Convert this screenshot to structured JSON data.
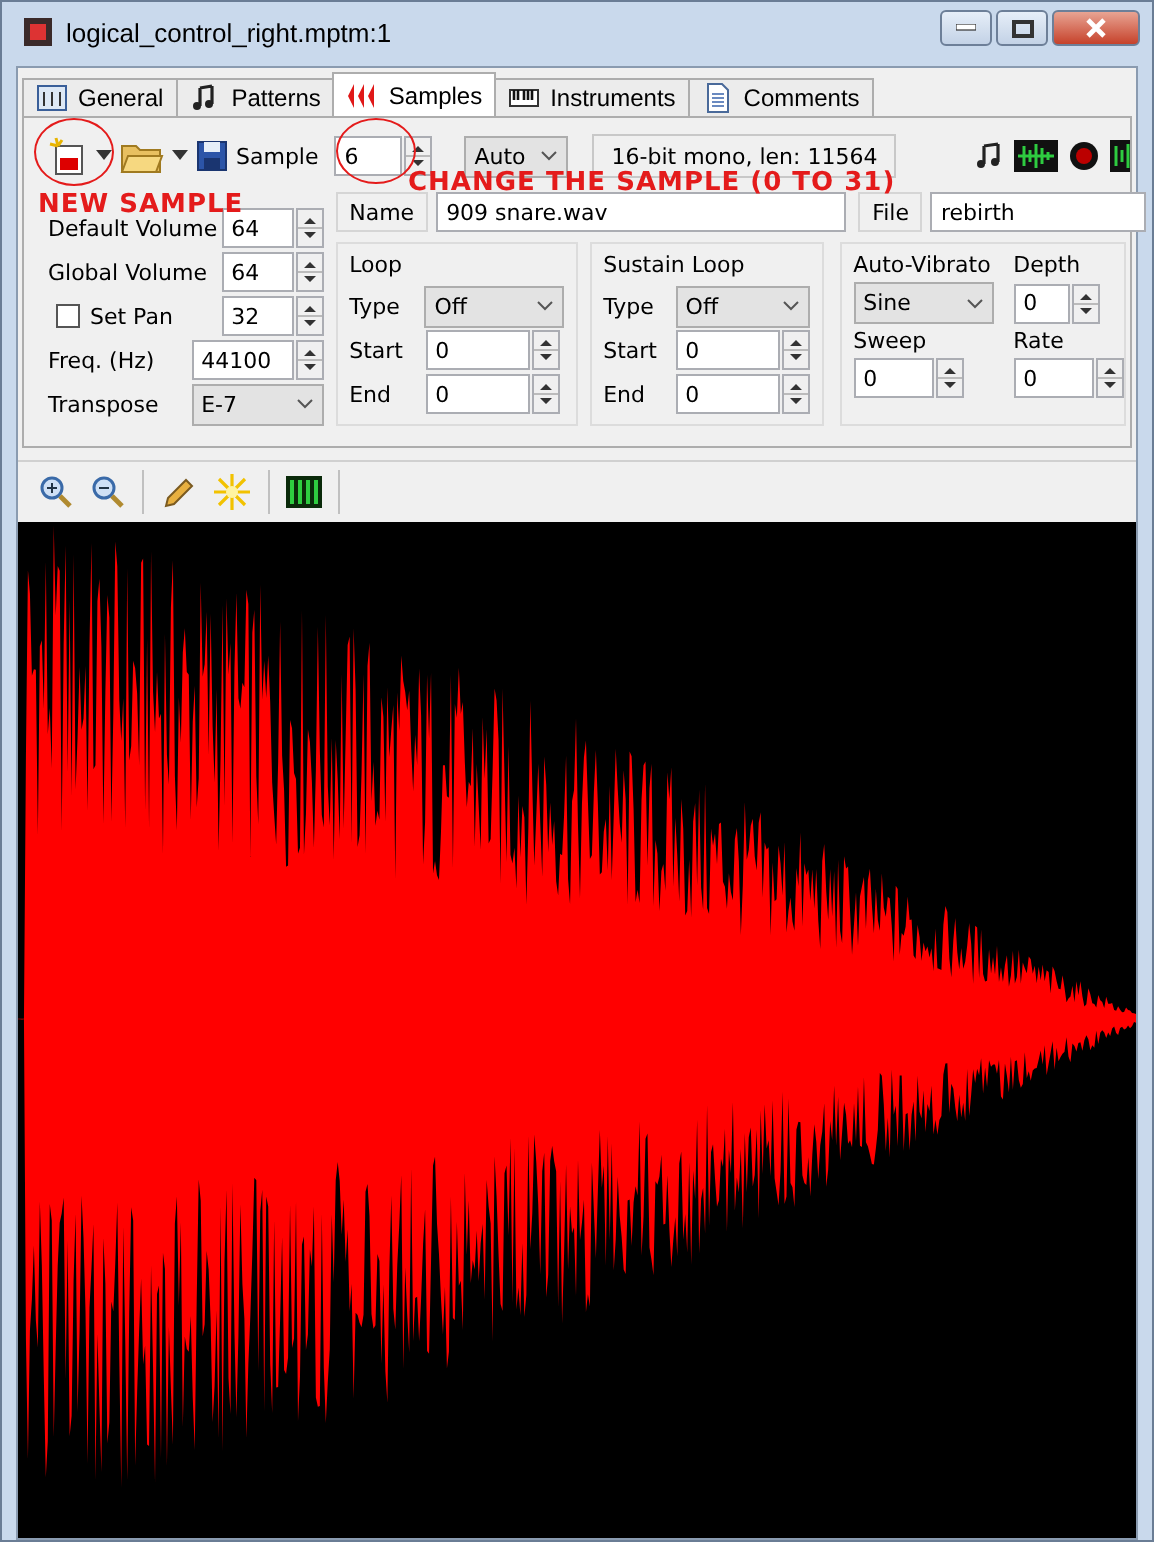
{
  "window": {
    "title": "logical_control_right.mptm:1"
  },
  "tabs": [
    {
      "label": "General",
      "selected": false
    },
    {
      "label": "Patterns",
      "selected": false
    },
    {
      "label": "Samples",
      "selected": true
    },
    {
      "label": "Instruments",
      "selected": false
    },
    {
      "label": "Comments",
      "selected": false
    }
  ],
  "toolbar": {
    "sample_label": "Sample",
    "sample": "6",
    "mode": "Auto",
    "info": "16-bit mono, len: 11564"
  },
  "annotations": [
    {
      "text": "NEW SAMPLE"
    },
    {
      "text": "CHANGE THE SAMPLE (0 TO 31)"
    }
  ],
  "properties": [
    {
      "kind": "spin",
      "label": "Default Volume",
      "value": "64"
    },
    {
      "kind": "spin",
      "label": "Global Volume",
      "value": "64"
    },
    {
      "kind": "check",
      "label": "Set Pan",
      "checked": false,
      "value": "32"
    },
    {
      "kind": "wide",
      "label": "Freq. (Hz)",
      "value": "44100"
    },
    {
      "kind": "dropdown",
      "label": "Transpose",
      "value": "E-7"
    }
  ],
  "name": {
    "label": "Name",
    "value": "909 snare.wav"
  },
  "file": {
    "label": "File",
    "value": "rebirth"
  },
  "loop": {
    "title": "Loop",
    "type_label": "Type",
    "type": "Off",
    "start_label": "Start",
    "start": "0",
    "end_label": "End",
    "end": "0"
  },
  "sustain_loop": {
    "title": "Sustain Loop",
    "type_label": "Type",
    "type": "Off",
    "start_label": "Start",
    "start": "0",
    "end_label": "End",
    "end": "0"
  },
  "auto_vibrato": {
    "title": "Auto-Vibrato",
    "type": "Sine",
    "depth_label": "Depth",
    "depth": "0",
    "sweep_label": "Sweep",
    "sweep": "0",
    "rate_label": "Rate",
    "rate": "0"
  }
}
